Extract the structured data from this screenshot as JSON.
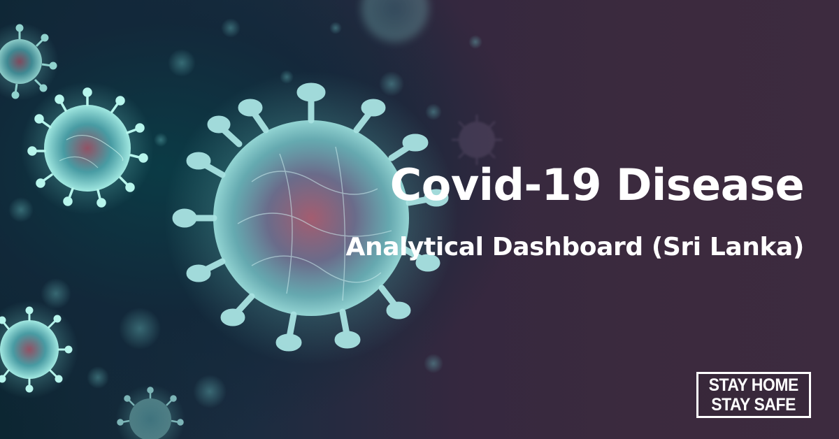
{
  "banner": {
    "title": "Covid-19 Disease",
    "subtitle": "Analytical Dashboard (Sri Lanka)",
    "badge": {
      "line1": "STAY HOME",
      "line2": "STAY SAFE"
    }
  },
  "illustration": {
    "subject": "coronavirus-particles",
    "colors": {
      "background_dark": "#0c2632",
      "background_purple": "#3b2a3e",
      "virus_teal": "#7fd3d6",
      "virus_core_red": "#8a3a4e",
      "text": "#ffffff"
    }
  }
}
